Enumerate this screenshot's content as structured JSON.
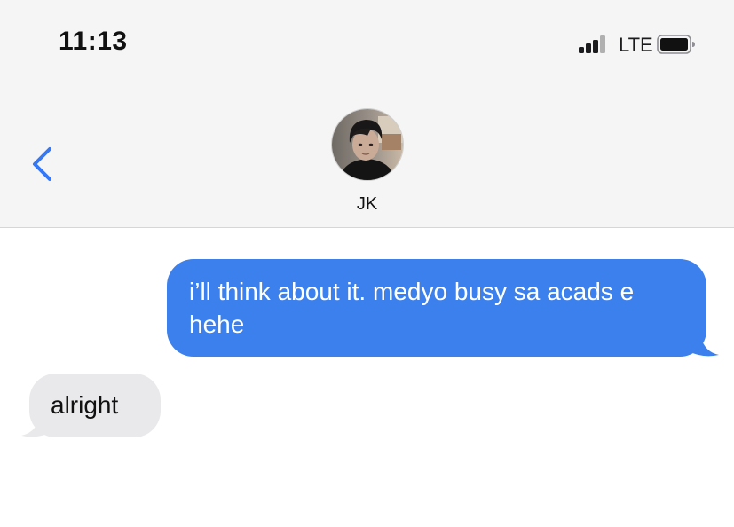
{
  "status_bar": {
    "time": "11:13",
    "network": "LTE",
    "signal_bars_active": 3,
    "signal_bars_total": 4
  },
  "conversation": {
    "contact_name": "JK",
    "messages": [
      {
        "direction": "outgoing",
        "text": "i’ll think about it. medyo busy sa acads e hehe"
      },
      {
        "direction": "incoming",
        "text": "alright"
      }
    ]
  },
  "colors": {
    "outgoing_bubble": "#3b80ec",
    "incoming_bubble": "#e9e9eb",
    "accent": "#3478f6",
    "header_bg": "#f5f5f5"
  },
  "icons": {
    "back": "chevron-left-icon",
    "signal": "cellular-signal-icon",
    "battery": "battery-icon"
  }
}
